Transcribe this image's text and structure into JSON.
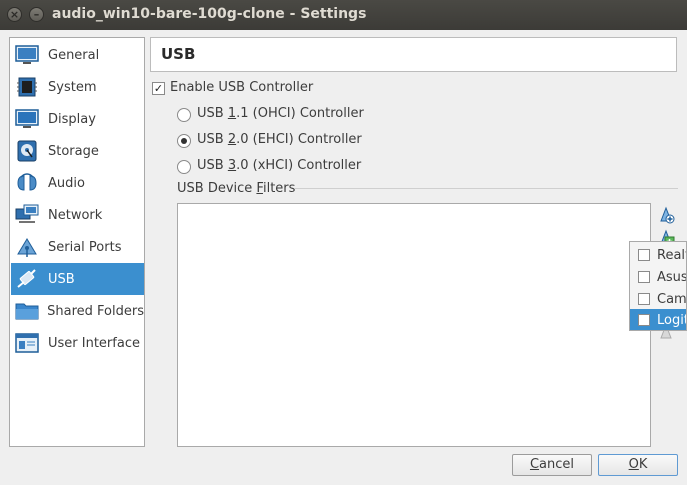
{
  "window": {
    "title": "audio_win10-bare-100g-clone - Settings"
  },
  "sidebar": {
    "items": [
      {
        "label": "General",
        "icon": "general-icon"
      },
      {
        "label": "System",
        "icon": "system-icon"
      },
      {
        "label": "Display",
        "icon": "display-icon"
      },
      {
        "label": "Storage",
        "icon": "storage-icon"
      },
      {
        "label": "Audio",
        "icon": "audio-icon"
      },
      {
        "label": "Network",
        "icon": "network-icon"
      },
      {
        "label": "Serial Ports",
        "icon": "serial-ports-icon"
      },
      {
        "label": "USB",
        "icon": "usb-icon",
        "selected": true
      },
      {
        "label": "Shared Folders",
        "icon": "shared-folders-icon"
      },
      {
        "label": "User Interface",
        "icon": "user-interface-icon"
      }
    ]
  },
  "page": {
    "title": "USB"
  },
  "usb": {
    "enable_label": "Enable USB Controller",
    "enabled": true,
    "controllers": [
      {
        "pre": "USB ",
        "accel": "1",
        "post": ".1 (OHCI) Controller",
        "selected": false
      },
      {
        "pre": "USB ",
        "accel": "2",
        "post": ".0 (EHCI) Controller",
        "selected": true
      },
      {
        "pre": "USB ",
        "accel": "3",
        "post": ".0 (xHCI) Controller",
        "selected": false
      }
    ],
    "filters_label_pre": "USB Device ",
    "filters_label_accel": "F",
    "filters_label_post": "ilters"
  },
  "device_menu": {
    "items": [
      {
        "label": "Realt",
        "selected": false
      },
      {
        "label": "AsusT",
        "selected": false
      },
      {
        "label": "Camb",
        "selected": false
      },
      {
        "label": "Logit",
        "selected": true
      }
    ]
  },
  "buttons": {
    "cancel_accel": "C",
    "cancel_rest": "ancel",
    "ok_accel": "O",
    "ok_rest": "K"
  },
  "colors": {
    "accent": "#3b8fcf",
    "titlebar": "#3c3b37"
  }
}
